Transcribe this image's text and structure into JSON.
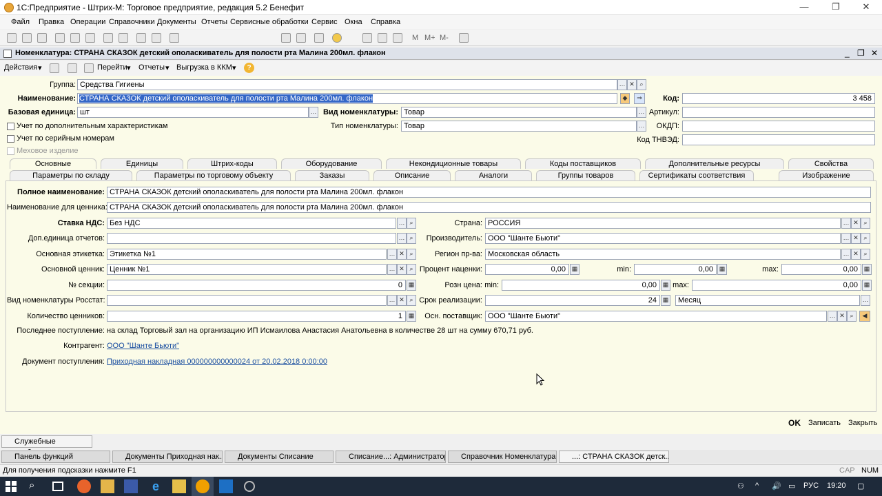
{
  "window": {
    "title": "1С:Предприятие - Штрих-М: Торговое предприятие, редакция 5.2 Бенефит"
  },
  "menu": [
    "Файл",
    "Правка",
    "Операции",
    "Справочники",
    "Документы",
    "Отчеты",
    "Сервисные обработки",
    "Сервис",
    "Окна",
    "Справка"
  ],
  "toolbar_labels": {
    "m": "M",
    "mplus": "M+",
    "mminus": "M-"
  },
  "doc_title": "Номенклатура: СТРАНА СКАЗОК детский ополаскиватель для полости рта Малина 200мл. флакон",
  "actions": {
    "deystviya": "Действия",
    "pereyti": "Перейти",
    "otchety": "Отчеты",
    "vygruzka": "Выгрузка в ККМ"
  },
  "header": {
    "gruppa_label": "Группа:",
    "gruppa_value": "Средства Гигиены",
    "naim_label": "Наименование:",
    "naim_value": "СТРАНА СКАЗОК детский ополаскиватель для полости рта Малина 200мл. флакон",
    "kod_label": "Код:",
    "kod_value": "3 458",
    "baz_label": "Базовая единица:",
    "baz_value": "шт",
    "vid_label": "Вид номенклатуры:",
    "vid_value": "Товар",
    "artikul_label": "Артикул:",
    "uchet_har": "Учет по дополнительным характеристикам",
    "tip_label": "Тип номенклатуры:",
    "tip_value": "Товар",
    "okdp_label": "ОКДП:",
    "uchet_ser": "Учет по серийным номерам",
    "tnved_label": "Код ТНВЭД:",
    "meh": "Меховое изделие"
  },
  "tabs_row1": [
    "Основные",
    "Единицы",
    "Штрих-коды",
    "Оборудование",
    "Некондиционные товары",
    "Коды поставщиков",
    "Дополнительные ресурсы",
    "Свойства"
  ],
  "tabs_row2": [
    "Параметры по складу",
    "Параметры по торговому объекту",
    "Заказы",
    "Описание",
    "Аналоги",
    "Группы товаров",
    "Сертификаты соответствия",
    "Изображение"
  ],
  "main": {
    "poln_label": "Полное наименование:",
    "poln_value": "СТРАНА СКАЗОК детский ополаскиватель для полости рта Малина 200мл. флакон",
    "cen_label": "Наименование для ценника:",
    "cen_value": "СТРАНА СКАЗОК детский ополаскиватель для полости рта Малина 200мл. флакон",
    "nds_label": "Ставка НДС:",
    "nds_value": "Без НДС",
    "dop_label": "Доп.единица отчетов:",
    "etik_label": "Основная этикетка:",
    "etik_value": "Этикетка №1",
    "cennik_label": "Основной ценник:",
    "cennik_value": "Ценник №1",
    "sek_label": "№ секции:",
    "sek_value": "0",
    "rosstat_label": "Вид номенклатуры Росстат:",
    "kolcen_label": "Количество ценников:",
    "kolcen_value": "1",
    "strana_label": "Страна:",
    "strana_value": "РОССИЯ",
    "proizv_label": "Производитель:",
    "proizv_value": "ООО \"Шанте Бьюти\"",
    "region_label": "Регион пр-ва:",
    "region_value": "Московская область",
    "nacenka_label": "Процент наценки:",
    "nacenka_value": "0,00",
    "min_label": "min:",
    "min_value": "0,00",
    "max_label": "max:",
    "max_value": "0,00",
    "rozn_label": "Розн цена:",
    "rmin_label": "min:",
    "rmin_value": "0,00",
    "rmax_label": "max:",
    "rmax_value": "0,00",
    "srok_label": "Срок реализации:",
    "srok_value": "24",
    "srok_unit": "Месяц",
    "postav_label": "Осн. поставщик:",
    "postav_value": "ООО \"Шанте Бьюти\"",
    "posl_label": "Последнее поступление:",
    "posl_value": "на склад Торговый зал на организацию ИП Исмаилова Анастасия Анатольевна в количестве 28 шт на сумму 670,71 руб.",
    "kontr_label": "Контрагент:",
    "kontr_value": "ООО \"Шанте Бьюти\"",
    "doc_label": "Документ поступления:",
    "doc_value": "Приходная накладная 000000000000024 от 20.02.2018 0:00:00"
  },
  "footer_buttons": {
    "ok": "OK",
    "zapisat": "Записать",
    "zakryt": "Закрыть"
  },
  "service_messages": "Служебные сообщения",
  "window_tabs": [
    "Панель функций",
    "Документы Приходная нак...",
    "Документы Списание",
    "Списание...: Администратор *",
    "Справочник Номенклатура",
    "...: СТРАНА СКАЗОК детск..."
  ],
  "statusbar": {
    "hint": "Для получения подсказки нажмите F1",
    "cap": "CAP",
    "num": "NUM"
  },
  "taskbar": {
    "lang": "РУС",
    "time": "19:20"
  }
}
